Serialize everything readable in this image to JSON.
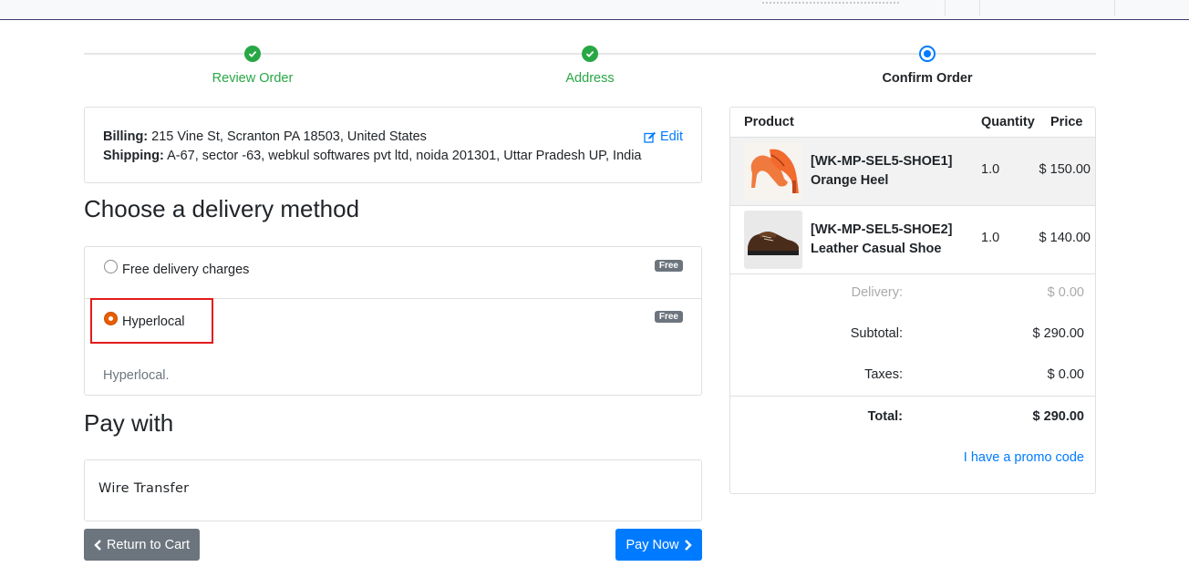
{
  "steps": [
    {
      "label": "Review Order",
      "state": "done"
    },
    {
      "label": "Address",
      "state": "done"
    },
    {
      "label": "Confirm Order",
      "state": "current"
    }
  ],
  "address": {
    "billing_label": "Billing:",
    "billing": "215 Vine St, Scranton PA 18503, United States",
    "shipping_label": "Shipping:",
    "shipping": "A-67, sector -63, webkul softwares pvt ltd, noida 201301, Uttar Pradesh UP, India",
    "edit_label": "Edit"
  },
  "delivery": {
    "heading": "Choose a delivery method",
    "options": [
      {
        "label": "Free delivery charges",
        "badge": "Free",
        "selected": false
      },
      {
        "label": "Hyperlocal",
        "badge": "Free",
        "selected": true,
        "description": "Hyperlocal."
      }
    ]
  },
  "payment": {
    "heading": "Pay with",
    "method": "Wire Transfer"
  },
  "buttons": {
    "back": "Return to Cart",
    "pay": "Pay Now"
  },
  "summary": {
    "headers": {
      "product": "Product",
      "quantity": "Quantity",
      "price": "Price"
    },
    "items": [
      {
        "code": "[WK-MP-SEL5-SHOE1]",
        "name": "Orange Heel",
        "qty": "1.0",
        "price": "$ 150.00",
        "thumb": "orange-heel-image"
      },
      {
        "code": "[WK-MP-SEL5-SHOE2]",
        "name": "Leather Casual Shoe",
        "qty": "1.0",
        "price": "$ 140.00",
        "thumb": "leather-shoe-image"
      }
    ],
    "delivery_label": "Delivery:",
    "delivery_value": "$ 0.00",
    "subtotal_label": "Subtotal:",
    "subtotal_value": "$ 290.00",
    "taxes_label": "Taxes:",
    "taxes_value": "$ 0.00",
    "total_label": "Total:",
    "total_value": "$ 290.00",
    "promo": "I have a promo code"
  },
  "colors": {
    "success": "#28a745",
    "primary": "#007bff",
    "secondary": "#6c757d",
    "highlight": "#e21b1b"
  }
}
